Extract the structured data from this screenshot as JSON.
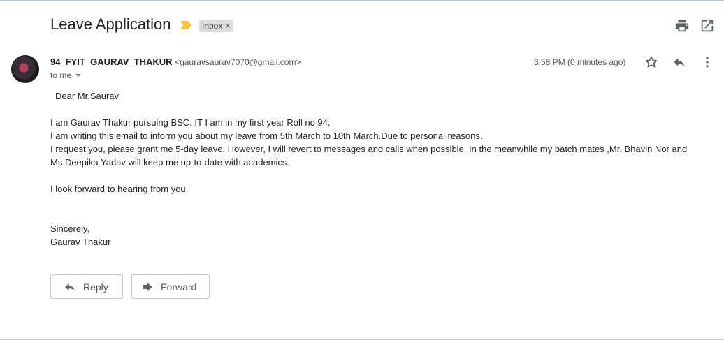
{
  "subject": "Leave Application",
  "label": {
    "name": "Inbox",
    "remove_glyph": "×"
  },
  "toolbar": {
    "print_icon": "print-icon",
    "open_new_window_icon": "open-in-new-icon"
  },
  "sender": {
    "name": "94_FYIT_GAURAV_THAKUR",
    "email": "<gauravsaurav7070@gmail.com>",
    "recipient": "to me"
  },
  "timestamp": "3:58 PM (0 minutes ago)",
  "message": {
    "greeting": "Dear Mr.Saurav",
    "line1": "I am Gaurav Thakur pursuing BSC. IT I am in my first year Roll no 94.",
    "line2": "I am writing this email to inform you about my leave from 5th March to 10th March.Due to personal reasons.",
    "line3": "I request you, please grant me 5-day leave. However, I will revert to messages and calls when possible, In the meanwhile my batch mates ,Mr. Bhavin Nor and Ms.Deepika Yadav will keep me up-to-date with academics.",
    "line4": "I look forward to hearing from you.",
    "closing": "Sincerely,",
    "signature": "Gaurav Thakur"
  },
  "actions": {
    "reply_label": "Reply",
    "forward_label": "Forward"
  },
  "colors": {
    "importance": "#f6c342",
    "icon": "#5f6368",
    "chip_bg": "#dddddd"
  }
}
